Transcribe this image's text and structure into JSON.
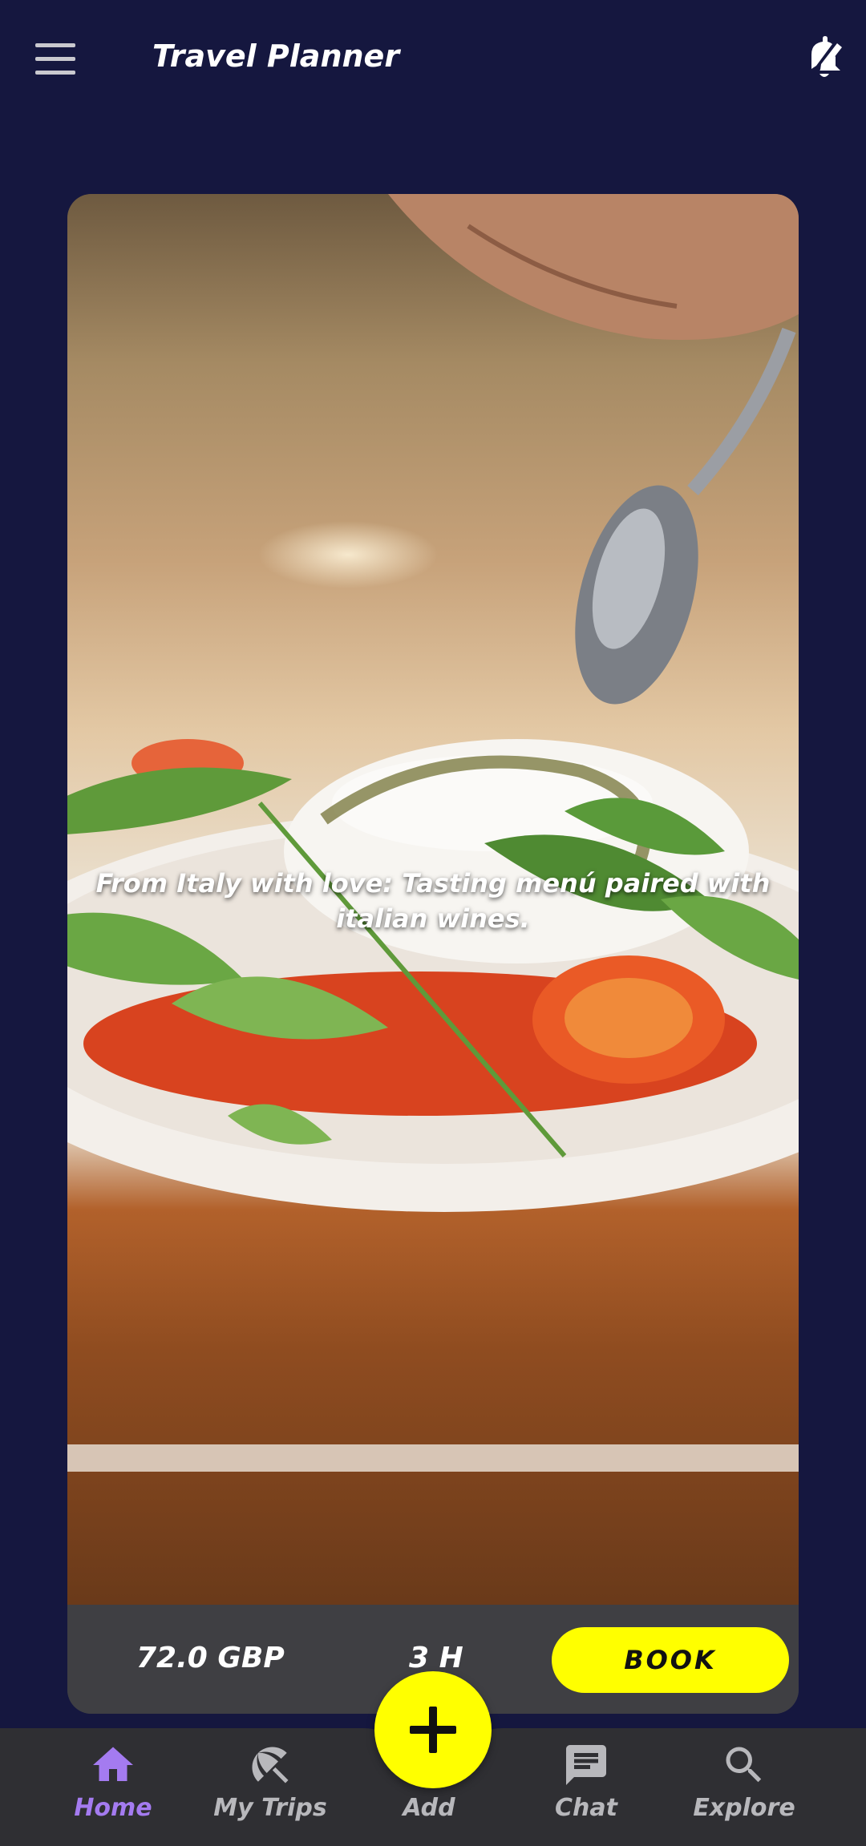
{
  "appbar": {
    "title": "Travel Planner",
    "menu_icon": "hamburger-menu-icon",
    "action_icon": "edit-notification-bell-icon"
  },
  "card": {
    "image_description_icon": "food-photo",
    "caption": "From Italy with love: Tasting menú paired with italian wines.",
    "price": "72.0 GBP",
    "duration": "3 H",
    "book_label": "BOOK"
  },
  "bottom_nav": {
    "items": [
      {
        "label": "Home",
        "icon": "home-icon",
        "active": true
      },
      {
        "label": "My Trips",
        "icon": "beach-umbrella-icon",
        "active": false
      },
      {
        "label": "Add",
        "icon": "plus-icon",
        "active": false
      },
      {
        "label": "Chat",
        "icon": "chat-icon",
        "active": false
      },
      {
        "label": "Explore",
        "icon": "search-icon",
        "active": false
      }
    ]
  },
  "colors": {
    "background": "#15173f",
    "accent": "#ffff00",
    "active_nav": "#a47bf0",
    "nav_bar": "#2f2f33"
  }
}
